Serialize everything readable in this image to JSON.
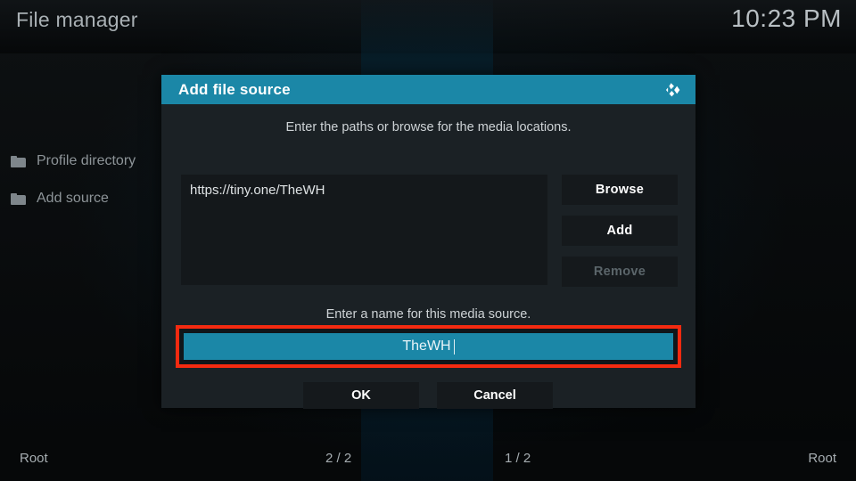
{
  "header": {
    "app_title": "File manager",
    "clock": "10:23 PM"
  },
  "sidebar": {
    "items": [
      {
        "label": "Profile directory",
        "icon": "folder-icon"
      },
      {
        "label": "Add source",
        "icon": "folder-icon"
      }
    ]
  },
  "dialog": {
    "title": "Add file source",
    "logo_icon": "kodi-logo-icon",
    "hint_paths": "Enter the paths or browse for the media locations.",
    "hint_name": "Enter a name for this media source.",
    "paths": [
      "https://tiny.one/TheWH"
    ],
    "side_buttons": [
      {
        "label": "Browse",
        "disabled": false
      },
      {
        "label": "Add",
        "disabled": false
      },
      {
        "label": "Remove",
        "disabled": true
      }
    ],
    "name_value": "TheWH",
    "ok_label": "OK",
    "cancel_label": "Cancel"
  },
  "statusbar": {
    "left": "Root",
    "center_left": "2 / 2",
    "center_right": "1 / 2",
    "right": "Root"
  },
  "colors": {
    "accent_teal": "#1b87a7",
    "highlight_red": "#f42a10",
    "dialog_bg": "#1b2125",
    "button_bg": "#15191c",
    "disabled_text": "#5b656a"
  }
}
